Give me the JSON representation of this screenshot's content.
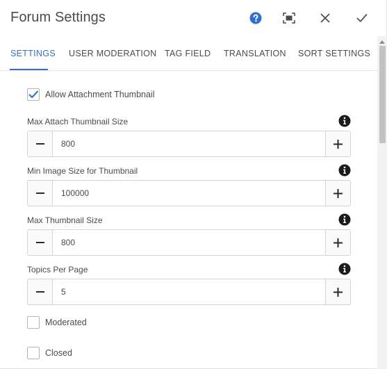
{
  "dialog": {
    "title": "Forum Settings",
    "actions": {
      "help": "help-icon",
      "fullscreen": "fullscreen-icon",
      "close": "close-icon",
      "done": "check-icon"
    }
  },
  "tabs": [
    {
      "label": "SETTINGS",
      "active": true
    },
    {
      "label": "USER MODERATION",
      "active": false
    },
    {
      "label": "TAG FIELD",
      "active": false
    },
    {
      "label": "TRANSLATION",
      "active": false
    },
    {
      "label": "SORT SETTINGS",
      "active": false
    }
  ],
  "settings": {
    "allow_attachment_thumbnail": {
      "label": "Allow Attachment Thumbnail",
      "checked": true
    },
    "max_attach_thumbnail_size": {
      "label": "Max Attach Thumbnail Size",
      "value": "800"
    },
    "min_image_size": {
      "label": "Min Image Size for Thumbnail",
      "value": "100000"
    },
    "max_thumbnail_size": {
      "label": "Max Thumbnail Size",
      "value": "800"
    },
    "topics_per_page": {
      "label": "Topics Per Page",
      "value": "5"
    },
    "moderated": {
      "label": "Moderated",
      "checked": false
    },
    "closed": {
      "label": "Closed",
      "checked": false
    }
  },
  "colors": {
    "accent": "#326ec8",
    "help": "#2f6fcf",
    "text": "#4b4b4b",
    "border": "#d3d3d3"
  }
}
